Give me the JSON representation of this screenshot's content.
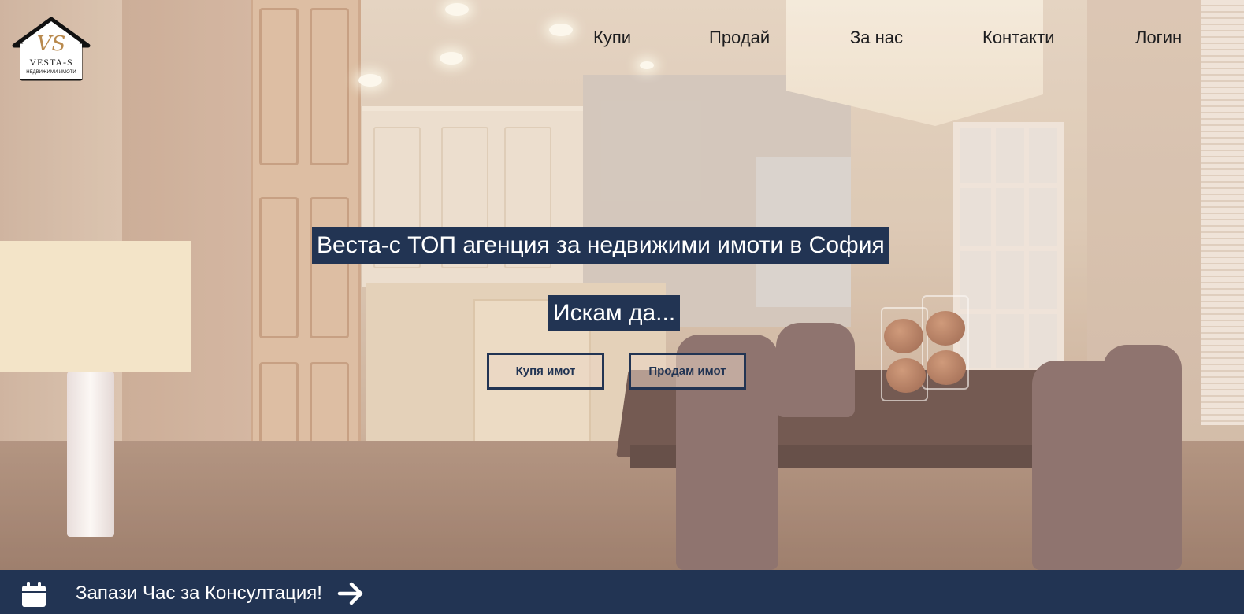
{
  "logo": {
    "monogram": "VS",
    "brand": "VESTA-S",
    "tagline": "НЕДВИЖИМИ ИМОТИ"
  },
  "nav": {
    "items": [
      {
        "label": "Купи"
      },
      {
        "label": "Продай"
      },
      {
        "label": "За нас"
      },
      {
        "label": "Контакти"
      },
      {
        "label": "Логин"
      }
    ]
  },
  "hero": {
    "headline": "Веста-с ТОП агенция за недвижими имоти в София",
    "subhead": "Искам да...",
    "buttons": {
      "buy_label": "Купя имот",
      "sell_label": "Продам имот"
    }
  },
  "footer_bar": {
    "consultation_label": "Запази Час за Консултация!",
    "calendar_icon": "calendar-icon",
    "arrow_icon": "arrow-right-icon"
  },
  "colors": {
    "accent": "#223453",
    "nav_text": "#1d1d1f",
    "logo_gold": "#b98a4e"
  }
}
